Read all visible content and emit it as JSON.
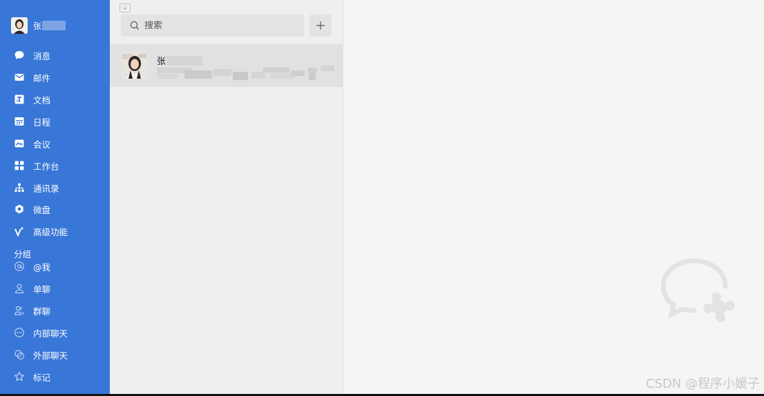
{
  "profile": {
    "name": "张"
  },
  "nav": [
    {
      "label": "消息",
      "icon": "chat-bubble-icon"
    },
    {
      "label": "邮件",
      "icon": "mail-icon"
    },
    {
      "label": "文档",
      "icon": "document-icon"
    },
    {
      "label": "日程",
      "icon": "calendar-icon"
    },
    {
      "label": "会议",
      "icon": "meeting-icon"
    },
    {
      "label": "工作台",
      "icon": "grid-icon"
    },
    {
      "label": "通讯录",
      "icon": "org-chart-icon"
    },
    {
      "label": "微盘",
      "icon": "drive-icon"
    },
    {
      "label": "高级功能",
      "icon": "sparkle-icon"
    }
  ],
  "group_heading": "分组",
  "groups": [
    {
      "label": "@我",
      "icon": "at-icon"
    },
    {
      "label": "单聊",
      "icon": "person-icon"
    },
    {
      "label": "群聊",
      "icon": "group-icon"
    },
    {
      "label": "内部聊天",
      "icon": "internal-chat-icon"
    },
    {
      "label": "外部聊天",
      "icon": "external-chat-icon"
    },
    {
      "label": "标记",
      "icon": "star-icon"
    }
  ],
  "search": {
    "placeholder": "搜索"
  },
  "conversation": {
    "name": "张"
  },
  "watermark": "CSDN @程序小媛子",
  "colors": {
    "sidebar": "#3876d8",
    "list_bg": "#efefef",
    "main_bg": "#f5f5f5"
  }
}
